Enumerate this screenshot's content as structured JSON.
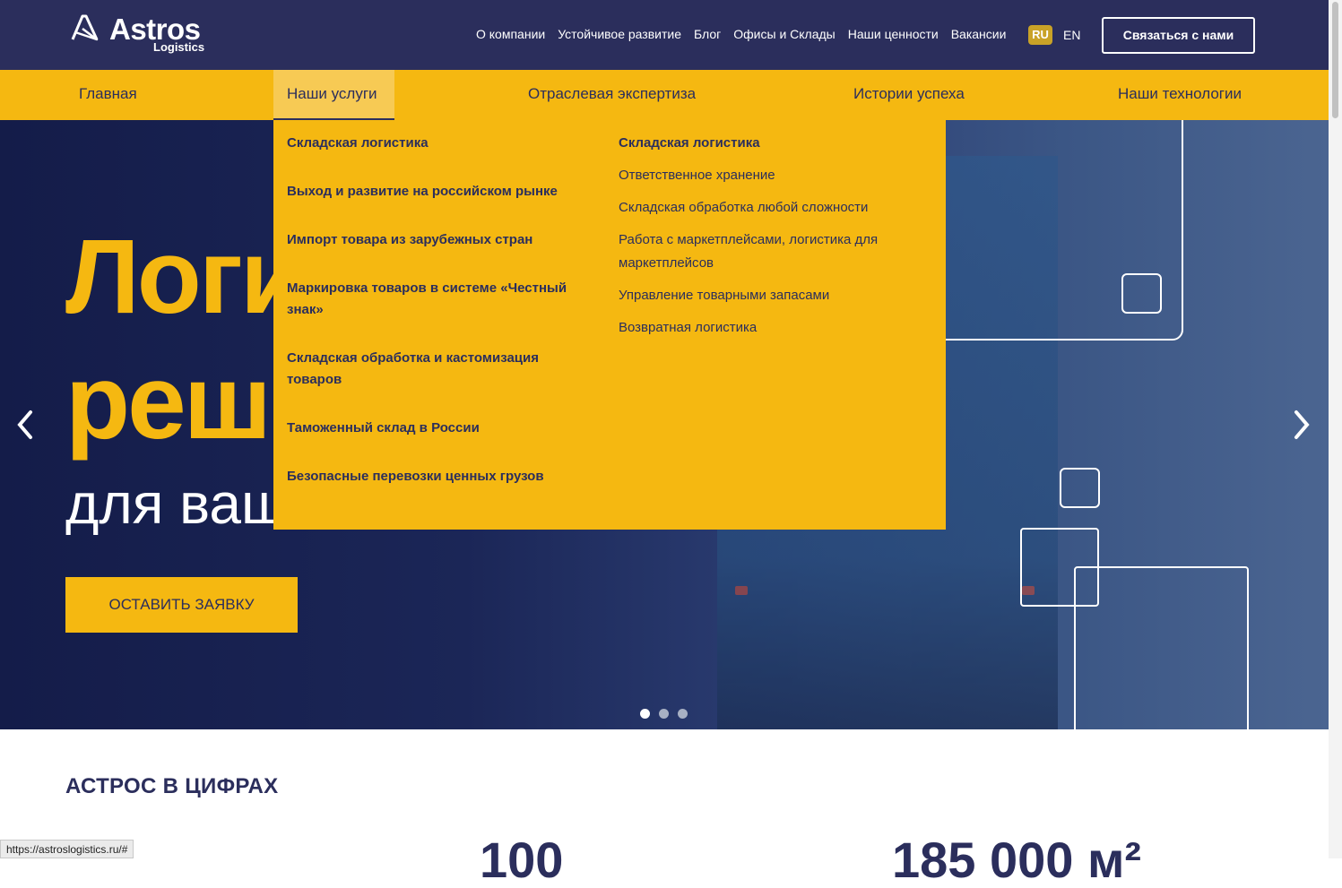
{
  "header": {
    "logo_text": "Astros",
    "logo_sub": "Logistics",
    "links": [
      "О компании",
      "Устойчивое развитие",
      "Блог",
      "Офисы и Склады",
      "Наши ценности",
      "Вакансии"
    ],
    "lang_ru": "RU",
    "lang_en": "EN",
    "contact_label": "Связаться с нами"
  },
  "nav": {
    "items": [
      "Главная",
      "Наши услуги",
      "Отраслевая экспертиза",
      "Истории успеха",
      "Наши технологии"
    ],
    "active_index": 1
  },
  "dropdown": {
    "main_items": [
      "Складская логистика",
      "Выход и развитие на российском рынке",
      "Импорт товара из зарубежных стран",
      "Маркировка товаров в системе «Честный знак»",
      "Складская обработка и кастомизация товаров",
      "Таможенный склад в России",
      "Безопасные перевозки ценных грузов"
    ],
    "sub_heading": "Складская логистика",
    "sub_items": [
      "Ответственное хранение",
      "Складская обработка любой сложности",
      "Работа с маркетплейсами, логистика для маркетплейсов",
      "Управление товарными запасами",
      "Возвратная логистика"
    ]
  },
  "hero": {
    "title_line1": "Логи",
    "title_line2": "реш",
    "subtitle": "для ваш",
    "cta_label": "ОСТАВИТЬ ЗАЯВКУ",
    "prev_arrow": "‹",
    "next_arrow": "›",
    "slides_count": 3,
    "active_slide": 0
  },
  "stats": {
    "title": "АСТРОС В ЦИФРАХ",
    "num1": "100",
    "num2": "185 000 м²"
  },
  "status_bar": {
    "url": "https://astroslogistics.ru/#"
  },
  "colors": {
    "navy": "#2b2e5c",
    "yellow": "#f5b811",
    "white": "#ffffff"
  }
}
